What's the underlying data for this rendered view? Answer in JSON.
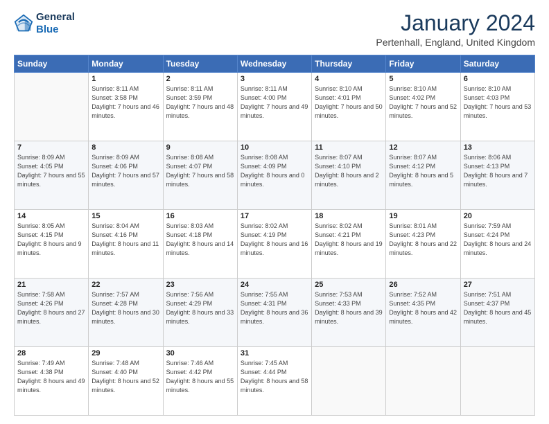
{
  "logo": {
    "line1": "General",
    "line2": "Blue"
  },
  "title": "January 2024",
  "location": "Pertenhall, England, United Kingdom",
  "days_of_week": [
    "Sunday",
    "Monday",
    "Tuesday",
    "Wednesday",
    "Thursday",
    "Friday",
    "Saturday"
  ],
  "weeks": [
    [
      {
        "day": "",
        "sunrise": "",
        "sunset": "",
        "daylight": ""
      },
      {
        "day": "1",
        "sunrise": "Sunrise: 8:11 AM",
        "sunset": "Sunset: 3:58 PM",
        "daylight": "Daylight: 7 hours and 46 minutes."
      },
      {
        "day": "2",
        "sunrise": "Sunrise: 8:11 AM",
        "sunset": "Sunset: 3:59 PM",
        "daylight": "Daylight: 7 hours and 48 minutes."
      },
      {
        "day": "3",
        "sunrise": "Sunrise: 8:11 AM",
        "sunset": "Sunset: 4:00 PM",
        "daylight": "Daylight: 7 hours and 49 minutes."
      },
      {
        "day": "4",
        "sunrise": "Sunrise: 8:10 AM",
        "sunset": "Sunset: 4:01 PM",
        "daylight": "Daylight: 7 hours and 50 minutes."
      },
      {
        "day": "5",
        "sunrise": "Sunrise: 8:10 AM",
        "sunset": "Sunset: 4:02 PM",
        "daylight": "Daylight: 7 hours and 52 minutes."
      },
      {
        "day": "6",
        "sunrise": "Sunrise: 8:10 AM",
        "sunset": "Sunset: 4:03 PM",
        "daylight": "Daylight: 7 hours and 53 minutes."
      }
    ],
    [
      {
        "day": "7",
        "sunrise": "Sunrise: 8:09 AM",
        "sunset": "Sunset: 4:05 PM",
        "daylight": "Daylight: 7 hours and 55 minutes."
      },
      {
        "day": "8",
        "sunrise": "Sunrise: 8:09 AM",
        "sunset": "Sunset: 4:06 PM",
        "daylight": "Daylight: 7 hours and 57 minutes."
      },
      {
        "day": "9",
        "sunrise": "Sunrise: 8:08 AM",
        "sunset": "Sunset: 4:07 PM",
        "daylight": "Daylight: 7 hours and 58 minutes."
      },
      {
        "day": "10",
        "sunrise": "Sunrise: 8:08 AM",
        "sunset": "Sunset: 4:09 PM",
        "daylight": "Daylight: 8 hours and 0 minutes."
      },
      {
        "day": "11",
        "sunrise": "Sunrise: 8:07 AM",
        "sunset": "Sunset: 4:10 PM",
        "daylight": "Daylight: 8 hours and 2 minutes."
      },
      {
        "day": "12",
        "sunrise": "Sunrise: 8:07 AM",
        "sunset": "Sunset: 4:12 PM",
        "daylight": "Daylight: 8 hours and 5 minutes."
      },
      {
        "day": "13",
        "sunrise": "Sunrise: 8:06 AM",
        "sunset": "Sunset: 4:13 PM",
        "daylight": "Daylight: 8 hours and 7 minutes."
      }
    ],
    [
      {
        "day": "14",
        "sunrise": "Sunrise: 8:05 AM",
        "sunset": "Sunset: 4:15 PM",
        "daylight": "Daylight: 8 hours and 9 minutes."
      },
      {
        "day": "15",
        "sunrise": "Sunrise: 8:04 AM",
        "sunset": "Sunset: 4:16 PM",
        "daylight": "Daylight: 8 hours and 11 minutes."
      },
      {
        "day": "16",
        "sunrise": "Sunrise: 8:03 AM",
        "sunset": "Sunset: 4:18 PM",
        "daylight": "Daylight: 8 hours and 14 minutes."
      },
      {
        "day": "17",
        "sunrise": "Sunrise: 8:02 AM",
        "sunset": "Sunset: 4:19 PM",
        "daylight": "Daylight: 8 hours and 16 minutes."
      },
      {
        "day": "18",
        "sunrise": "Sunrise: 8:02 AM",
        "sunset": "Sunset: 4:21 PM",
        "daylight": "Daylight: 8 hours and 19 minutes."
      },
      {
        "day": "19",
        "sunrise": "Sunrise: 8:01 AM",
        "sunset": "Sunset: 4:23 PM",
        "daylight": "Daylight: 8 hours and 22 minutes."
      },
      {
        "day": "20",
        "sunrise": "Sunrise: 7:59 AM",
        "sunset": "Sunset: 4:24 PM",
        "daylight": "Daylight: 8 hours and 24 minutes."
      }
    ],
    [
      {
        "day": "21",
        "sunrise": "Sunrise: 7:58 AM",
        "sunset": "Sunset: 4:26 PM",
        "daylight": "Daylight: 8 hours and 27 minutes."
      },
      {
        "day": "22",
        "sunrise": "Sunrise: 7:57 AM",
        "sunset": "Sunset: 4:28 PM",
        "daylight": "Daylight: 8 hours and 30 minutes."
      },
      {
        "day": "23",
        "sunrise": "Sunrise: 7:56 AM",
        "sunset": "Sunset: 4:29 PM",
        "daylight": "Daylight: 8 hours and 33 minutes."
      },
      {
        "day": "24",
        "sunrise": "Sunrise: 7:55 AM",
        "sunset": "Sunset: 4:31 PM",
        "daylight": "Daylight: 8 hours and 36 minutes."
      },
      {
        "day": "25",
        "sunrise": "Sunrise: 7:53 AM",
        "sunset": "Sunset: 4:33 PM",
        "daylight": "Daylight: 8 hours and 39 minutes."
      },
      {
        "day": "26",
        "sunrise": "Sunrise: 7:52 AM",
        "sunset": "Sunset: 4:35 PM",
        "daylight": "Daylight: 8 hours and 42 minutes."
      },
      {
        "day": "27",
        "sunrise": "Sunrise: 7:51 AM",
        "sunset": "Sunset: 4:37 PM",
        "daylight": "Daylight: 8 hours and 45 minutes."
      }
    ],
    [
      {
        "day": "28",
        "sunrise": "Sunrise: 7:49 AM",
        "sunset": "Sunset: 4:38 PM",
        "daylight": "Daylight: 8 hours and 49 minutes."
      },
      {
        "day": "29",
        "sunrise": "Sunrise: 7:48 AM",
        "sunset": "Sunset: 4:40 PM",
        "daylight": "Daylight: 8 hours and 52 minutes."
      },
      {
        "day": "30",
        "sunrise": "Sunrise: 7:46 AM",
        "sunset": "Sunset: 4:42 PM",
        "daylight": "Daylight: 8 hours and 55 minutes."
      },
      {
        "day": "31",
        "sunrise": "Sunrise: 7:45 AM",
        "sunset": "Sunset: 4:44 PM",
        "daylight": "Daylight: 8 hours and 58 minutes."
      },
      {
        "day": "",
        "sunrise": "",
        "sunset": "",
        "daylight": ""
      },
      {
        "day": "",
        "sunrise": "",
        "sunset": "",
        "daylight": ""
      },
      {
        "day": "",
        "sunrise": "",
        "sunset": "",
        "daylight": ""
      }
    ]
  ]
}
